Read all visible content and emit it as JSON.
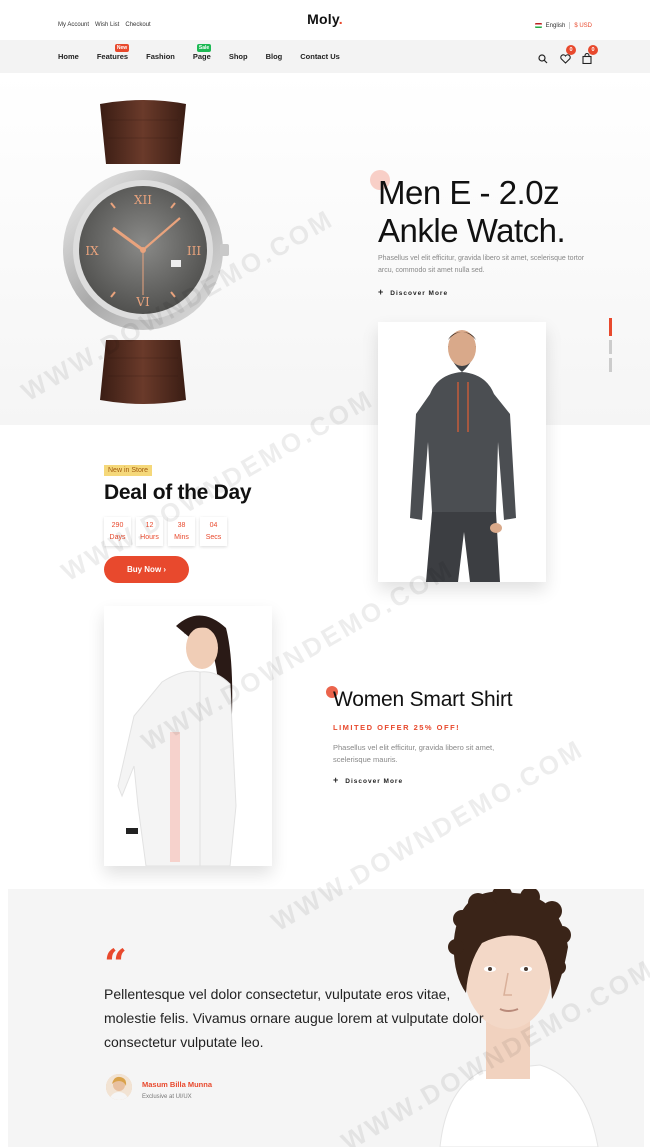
{
  "topbar": {
    "links": [
      "My Account",
      "Wish List",
      "Checkout"
    ],
    "logo": "Moly",
    "logo_dot": ".",
    "language": "English",
    "currency": "$ USD"
  },
  "nav": {
    "items": [
      {
        "label": "Home"
      },
      {
        "label": "Features",
        "tag": "New"
      },
      {
        "label": "Fashion"
      },
      {
        "label": "Page",
        "tag": "Sale"
      },
      {
        "label": "Shop"
      },
      {
        "label": "Blog"
      },
      {
        "label": "Contact Us"
      }
    ],
    "wishlist_count": "0",
    "cart_count": "0"
  },
  "hero": {
    "title_line1": "Men E - 2.0z",
    "title_line2": "Ankle Watch.",
    "description": "Phasellus vel elit efficitur, gravida libero sit amet, scelerisque tortor arcu, commodo sit amet nulla sed.",
    "discover": "Discover More",
    "slide_count": 3,
    "active_slide": 1
  },
  "deal": {
    "tag": "New in Store",
    "title": "Deal of the Day",
    "countdown": [
      {
        "value": "290",
        "unit": "Days"
      },
      {
        "value": "12",
        "unit": "Hours"
      },
      {
        "value": "38",
        "unit": "Mins"
      },
      {
        "value": "04",
        "unit": "Secs"
      }
    ],
    "button": "Buy Now ›"
  },
  "women": {
    "title": "Women Smart Shirt",
    "offer": "LIMITED OFFER 25% OFF!",
    "description": "Phasellus vel elit efficitur, gravida libero sit amet, scelerisque mauris.",
    "discover": "Discover More"
  },
  "testimonial": {
    "quote_mark": "“",
    "text": "Pellentesque vel dolor consectetur, vulputate eros vitae, molestie felis. Vivamus ornare augue lorem at vulputate dolor consectetur vulputate leo.",
    "author": "Masum Billa Munna",
    "role": "Exclusive at UI/UX"
  },
  "watermark": "WWW.DOWNDEMO.COM",
  "colors": {
    "accent": "#e8492d",
    "sale_green": "#1db954",
    "tag_yellow": "#f5d87a"
  }
}
